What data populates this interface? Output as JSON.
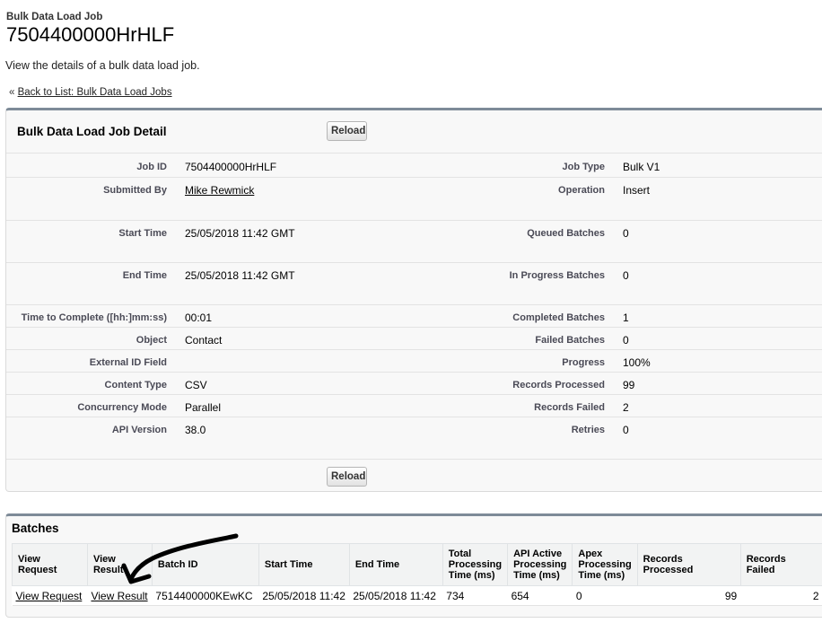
{
  "header": {
    "object_type": "Bulk Data Load Job",
    "record_name": "7504400000HrHLF",
    "description": "View the details of a bulk data load job.",
    "back_prefix": "«",
    "back_link": "Back to List: Bulk Data Load Jobs"
  },
  "detail": {
    "title": "Bulk Data Load Job Detail",
    "reload_label": "Reload",
    "rows": [
      {
        "l1": "Job ID",
        "v1": "7504400000HrHLF",
        "l2": "Job Type",
        "v2": "Bulk V1"
      },
      {
        "l1": "Submitted By",
        "v1": "Mike Rewmick",
        "l2": "Operation",
        "v2": "Insert"
      },
      {
        "l1": "Start Time",
        "v1": "25/05/2018 11:42 GMT",
        "l2": "Queued Batches",
        "v2": "0"
      },
      {
        "l1": "End Time",
        "v1": "25/05/2018 11:42 GMT",
        "l2": "In Progress Batches",
        "v2": "0"
      },
      {
        "l1": "Time to Complete ([hh:]mm:ss)",
        "v1": "00:01",
        "l2": "Completed Batches",
        "v2": "1"
      },
      {
        "l1": "Object",
        "v1": "Contact",
        "l2": "Failed Batches",
        "v2": "0"
      },
      {
        "l1": "External ID Field",
        "v1": "",
        "l2": "Progress",
        "v2": "100%"
      },
      {
        "l1": "Content Type",
        "v1": "CSV",
        "l2": "Records Processed",
        "v2": "99"
      },
      {
        "l1": "Concurrency Mode",
        "v1": "Parallel",
        "l2": "Records Failed",
        "v2": "2"
      },
      {
        "l1": "API Version",
        "v1": "38.0",
        "l2": "Retries",
        "v2": "0"
      }
    ]
  },
  "batches": {
    "title": "Batches",
    "columns": [
      {
        "label": "View Request"
      },
      {
        "label": "View Result"
      },
      {
        "label": "Batch ID"
      },
      {
        "label": "Start Time"
      },
      {
        "label": "End Time"
      },
      {
        "label": "Total Processing Time (ms)"
      },
      {
        "label": "API Active Processing Time (ms)"
      },
      {
        "label": "Apex Processing Time (ms)"
      },
      {
        "label": "Records Processed"
      },
      {
        "label": "Records Failed"
      }
    ],
    "rows": [
      {
        "view_request": "View Request",
        "view_result": "View Result",
        "batch_id": "7514400000KEwKC",
        "start_time": "25/05/2018 11:42",
        "end_time": "25/05/2018 11:42",
        "total_ms": "734",
        "api_ms": "654",
        "apex_ms": "0",
        "records_processed": "99",
        "records_failed": "2"
      }
    ]
  },
  "colors": {
    "block_border_top": "#7e8b98",
    "block_background": "#f8f8f8",
    "annotation_arrow": "#000000"
  }
}
